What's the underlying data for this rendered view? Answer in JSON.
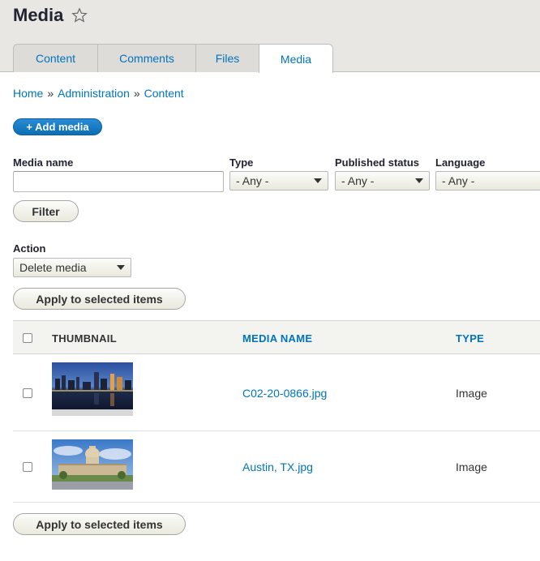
{
  "page": {
    "title": "Media"
  },
  "tabs": [
    {
      "label": "Content"
    },
    {
      "label": "Comments"
    },
    {
      "label": "Files"
    },
    {
      "label": "Media",
      "active": true
    }
  ],
  "breadcrumb": {
    "items": [
      "Home",
      "Administration",
      "Content"
    ],
    "separator": "»"
  },
  "actions": {
    "add_media_label": "+ Add media"
  },
  "filters": {
    "media_name_label": "Media name",
    "media_name_value": "",
    "type_label": "Type",
    "type_value": "- Any -",
    "published_label": "Published status",
    "published_value": "- Any -",
    "language_label": "Language",
    "language_value": "- Any -",
    "filter_button": "Filter"
  },
  "bulk": {
    "action_label": "Action",
    "action_value": "Delete media",
    "apply_label": "Apply to selected items"
  },
  "table": {
    "headers": {
      "thumbnail": "THUMBNAIL",
      "media_name": "MEDIA NAME",
      "type": "TYPE"
    },
    "rows": [
      {
        "name": "C02-20-0866.jpg",
        "type": "Image",
        "thumbnail": "city-skyline-night-thumbnail"
      },
      {
        "name": "Austin, TX.jpg",
        "type": "Image",
        "thumbnail": "capitol-building-thumbnail"
      }
    ]
  },
  "colors": {
    "link": "#0074bd",
    "primary": "#1a7bc2",
    "header_bg": "#e8e7e3"
  }
}
